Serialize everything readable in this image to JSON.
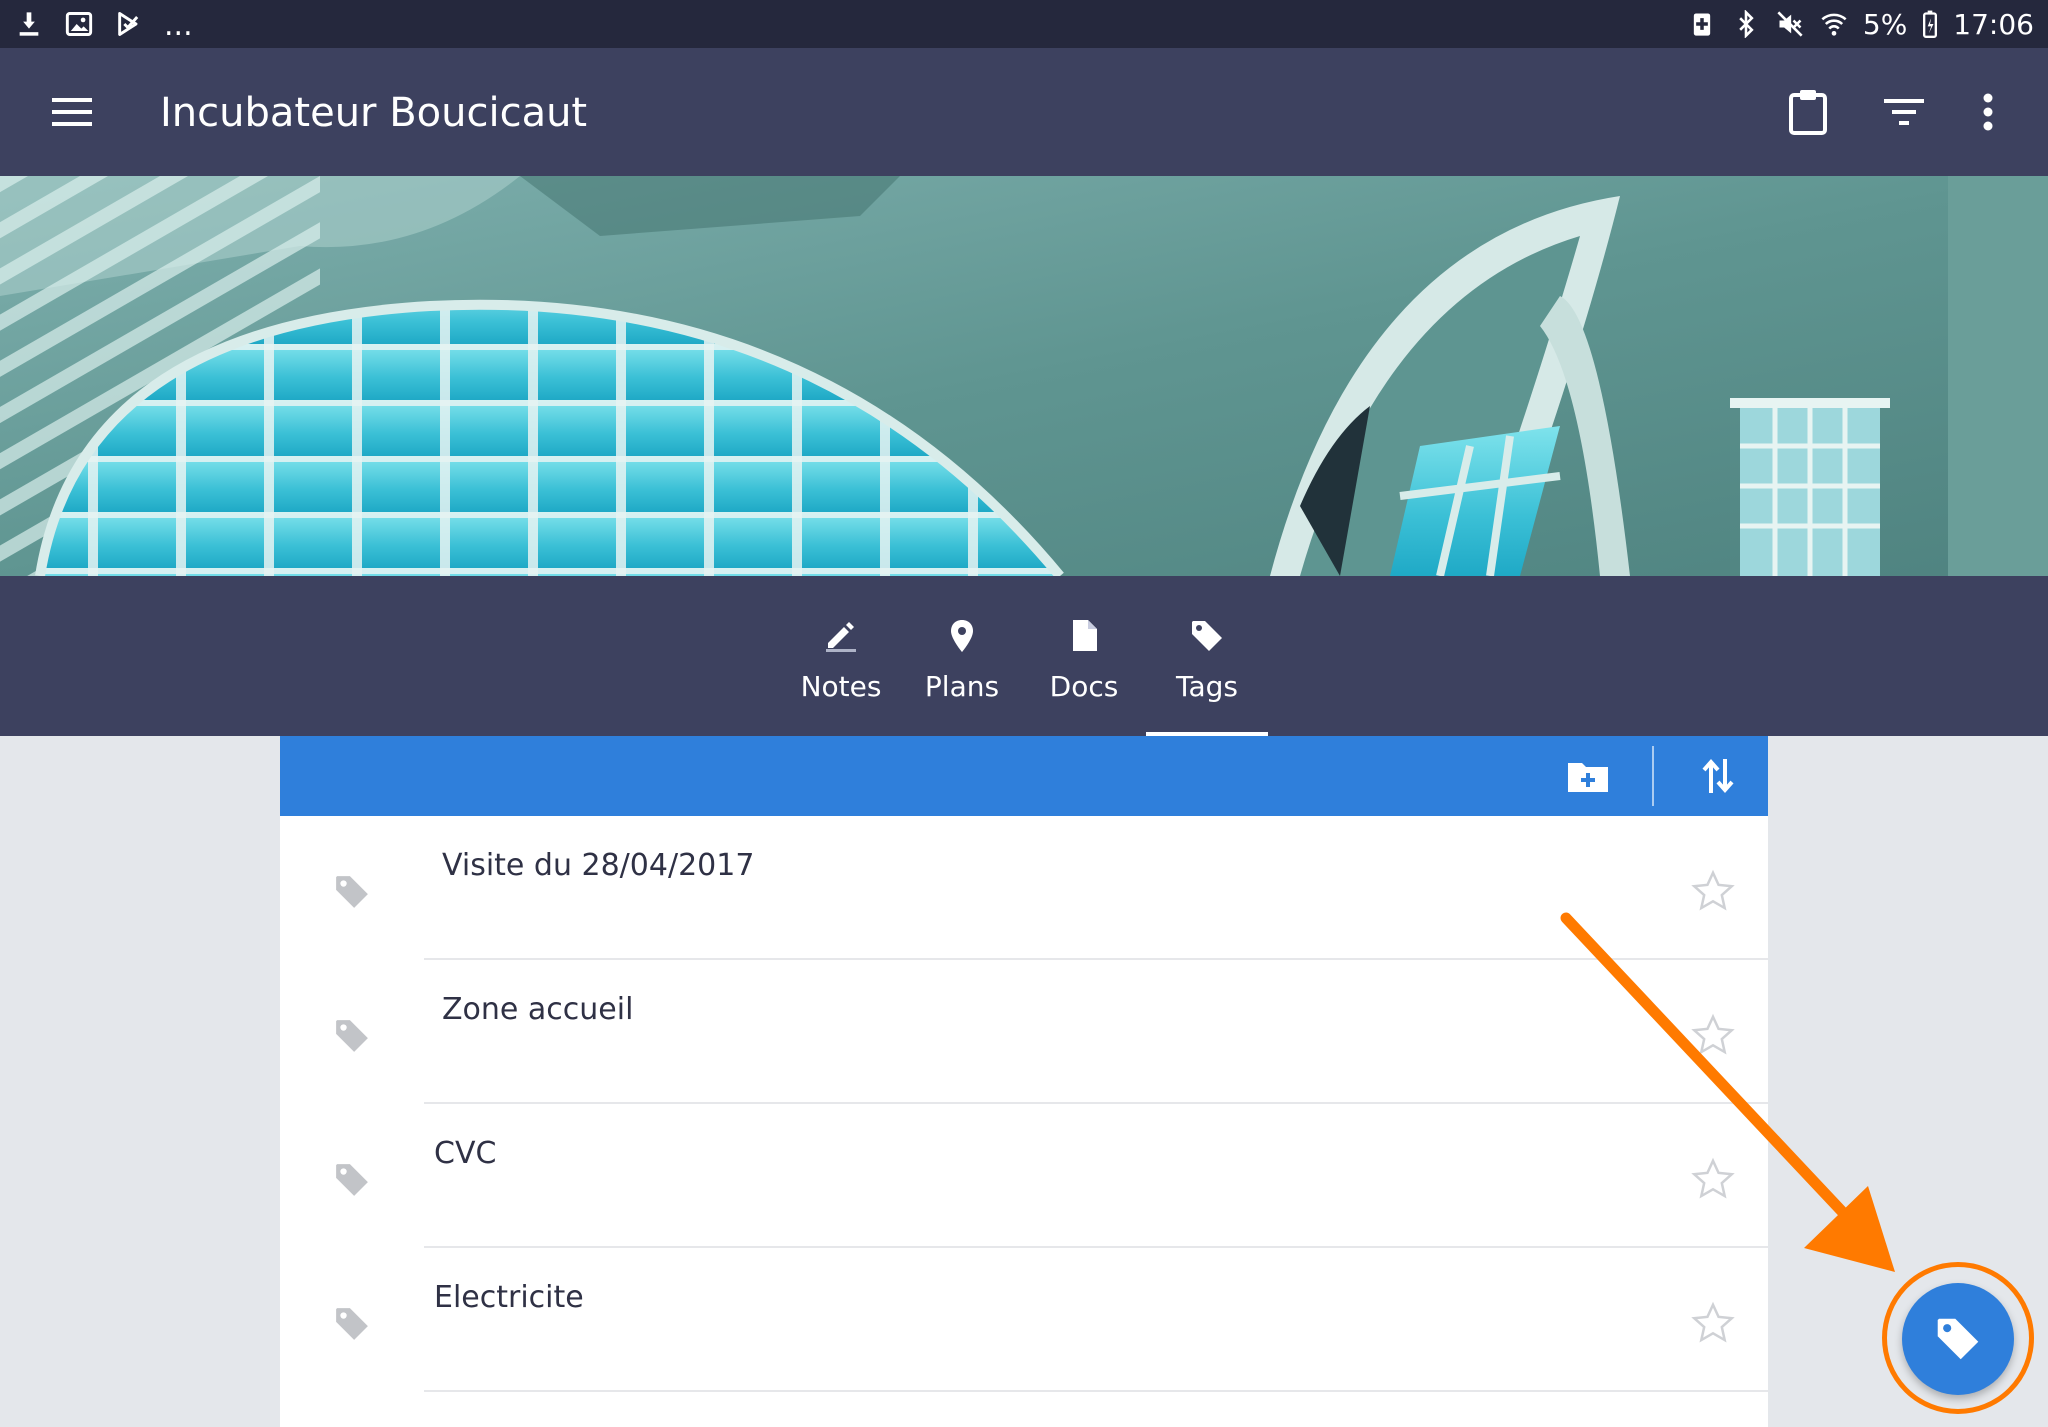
{
  "status_bar": {
    "battery_percent": "5%",
    "time": "17:06",
    "overflow_indicator": "..."
  },
  "app_bar": {
    "title": "Incubateur Boucicaut"
  },
  "tabs": [
    {
      "label": "Notes",
      "icon": "pencil-icon"
    },
    {
      "label": "Plans",
      "icon": "map-pin-icon"
    },
    {
      "label": "Docs",
      "icon": "document-icon"
    },
    {
      "label": "Tags",
      "icon": "tag-icon",
      "selected": true
    }
  ],
  "tag_list": {
    "items": [
      {
        "label": "Visite du 28/04/2017"
      },
      {
        "label": "Zone accueil"
      },
      {
        "label": "CVC"
      },
      {
        "label": "Electricite"
      }
    ]
  },
  "colors": {
    "status_bar": "#25283d",
    "app_bar": "#3d415f",
    "accent_blue": "#2f7fdb",
    "highlight_orange": "#ff7a00",
    "background": "#e4e7eb"
  }
}
